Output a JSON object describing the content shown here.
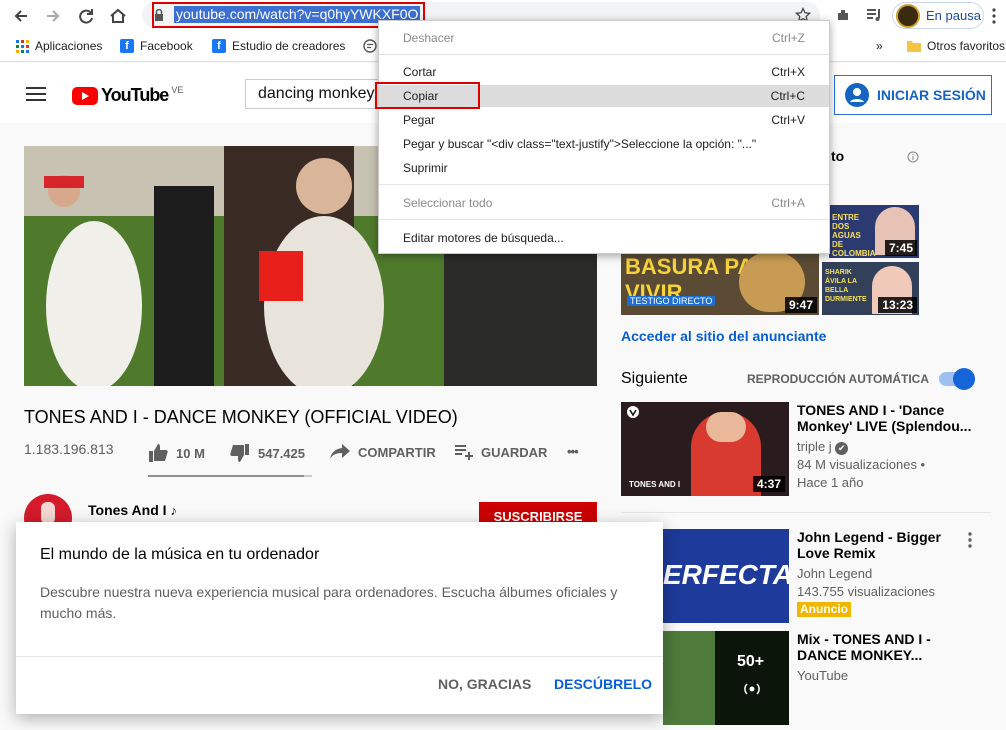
{
  "browser": {
    "url": "youtube.com/watch?v=q0hyYWKXF0O",
    "profile_status": "En pausa",
    "bookmarks": [
      "Aplicaciones",
      "Facebook",
      "Estudio de creadores",
      "Otros favoritos"
    ],
    "more_bookmarks_glyph": "»"
  },
  "header": {
    "logo_text": "YouTube",
    "region": "VE",
    "search_value": "dancing monkey",
    "signin_label": "INICIAR SESIÓN"
  },
  "context_menu": {
    "items": [
      {
        "label": "Deshacer",
        "shortcut": "Ctrl+Z"
      },
      {
        "label": "Cortar",
        "shortcut": "Ctrl+X"
      },
      {
        "label": "Copiar",
        "shortcut": "Ctrl+C"
      },
      {
        "label": "Pegar",
        "shortcut": "Ctrl+V"
      },
      {
        "label": "Pegar y buscar \"<div class=\"text-justify\">Seleccione la opción: \"...\"",
        "shortcut": ""
      },
      {
        "label": "Suprimir",
        "shortcut": ""
      },
      {
        "label": "Seleccionar todo",
        "shortcut": "Ctrl+A"
      },
      {
        "label": "Editar motores de búsqueda...",
        "shortcut": ""
      }
    ]
  },
  "video": {
    "title": "TONES AND I - DANCE MONKEY (OFFICIAL VIDEO)",
    "views": "1.183.196.813",
    "likes": "10 M",
    "dislikes": "547.425",
    "share_label": "COMPARTIR",
    "save_label": "GUARDAR",
    "more_glyph": "•••",
    "like_ratio": 0.95,
    "channel": "Tones And I",
    "channel_note": "♪",
    "subscribe_label": "SUSCRIBIRSE"
  },
  "promo": {
    "title": "El mundo de la música en tu ordenador",
    "body": "Descubre nuestra nueva experiencia musical para ordenadores. Escucha álbumes oficiales y mucho más.",
    "dismiss_label": "NO, GRACIAS",
    "accept_label": "DESCÚBRELO"
  },
  "sidebar": {
    "ad_heading_fragment": "to",
    "ad_thumbs": [
      {
        "caption": "ENTRE DOS AGUAS DE COLOMBIA",
        "duration": "7:45"
      },
      {
        "caption": "BASURA PARA VIVIR",
        "subcaption": "TESTIGO DIRECTO",
        "duration": "9:47"
      },
      {
        "caption": "SHARIK ÁVILA LA BELLA DURMIENTE",
        "duration": "13:23"
      }
    ],
    "ad_link": "Acceder al sitio del anunciante",
    "next_label": "Siguiente",
    "autoplay_label": "REPRODUCCIÓN AUTOMÁTICA",
    "autoplay_on": true,
    "items": [
      {
        "title_1": "TONES AND I - 'Dance",
        "title_2": "Monkey' LIVE (Splendou...",
        "channel": "triple j",
        "verified": "✔",
        "views": "84 M visualizaciones •",
        "age": "Hace 1 año",
        "duration": "4:37",
        "thumb_text": "TONES AND I"
      },
      {
        "title_1": "John Legend - Bigger",
        "title_2": "Love Remix",
        "channel": "John Legend",
        "views": "143.755 visualizaciones",
        "badge": "Anuncio",
        "thumb_text": "ERFECTA"
      },
      {
        "title_1": "Mix - TONES AND I -",
        "title_2": "DANCE MONKEY...",
        "channel": "YouTube",
        "count": "50+"
      }
    ]
  },
  "colors": {
    "youtube_red": "#ff0000",
    "link_blue": "#065fd4",
    "highlight": "#3b6fd0",
    "annotation_red": "#d00000"
  }
}
